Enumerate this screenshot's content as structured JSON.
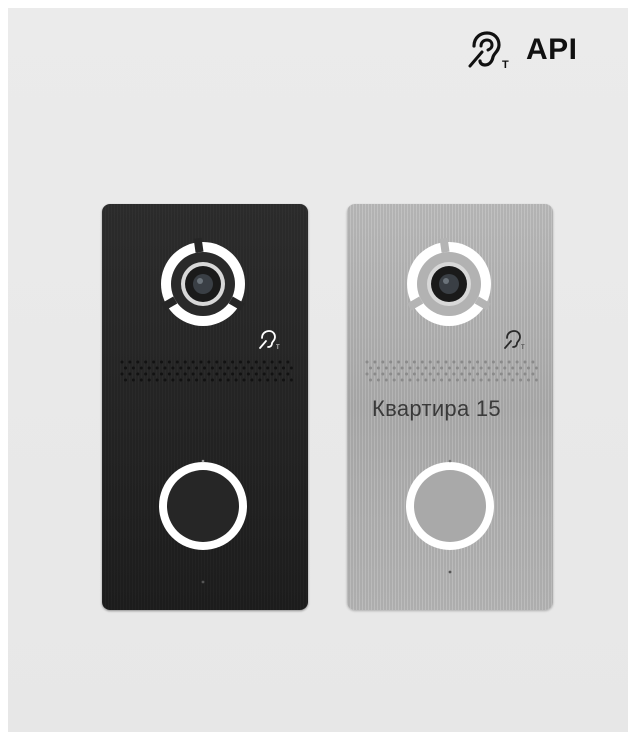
{
  "header": {
    "hearing_icon": "hearing-loop-icon",
    "label": "API"
  },
  "panels": [
    {
      "finish": "black",
      "color": "#222222"
    },
    {
      "finish": "silver",
      "color": "#b3b3b3",
      "apartment_label": "Квартира 15"
    }
  ]
}
